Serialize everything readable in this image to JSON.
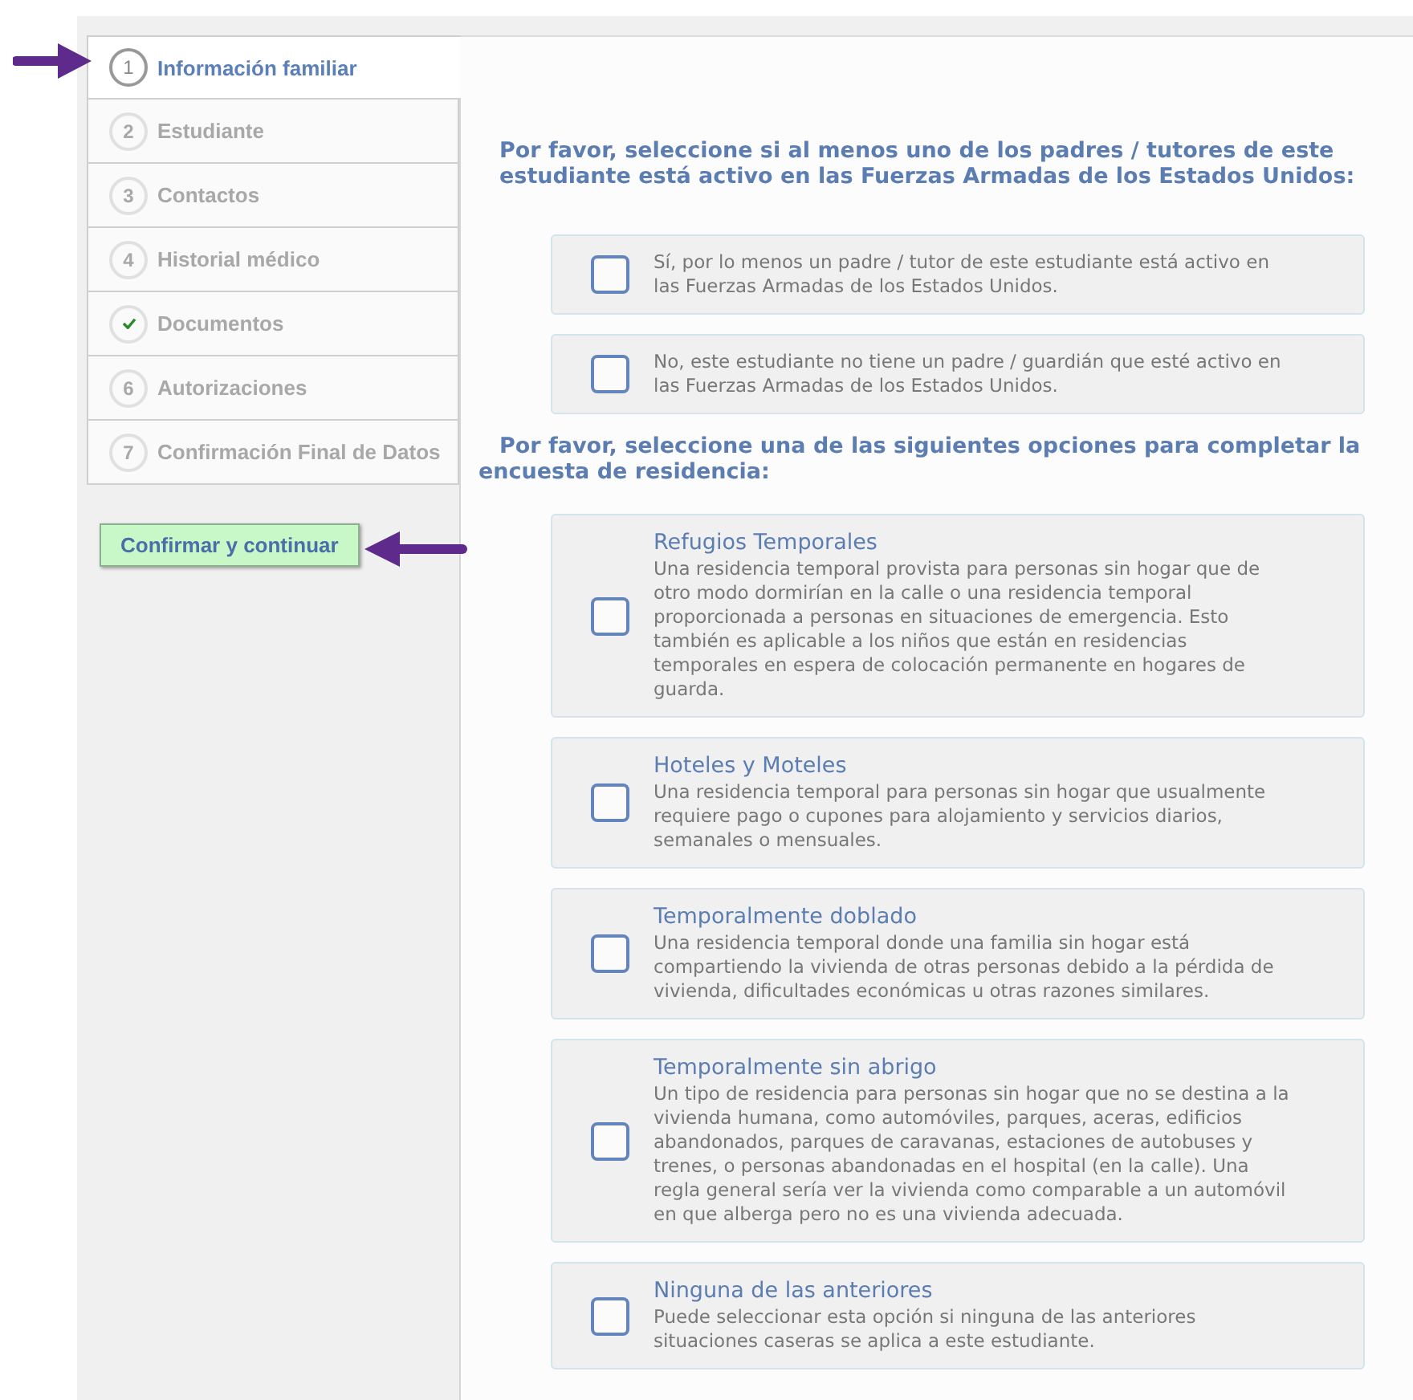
{
  "steps": [
    {
      "number": "1",
      "label": "Información familiar",
      "selected": true,
      "completed": false
    },
    {
      "number": "2",
      "label": "Estudiante",
      "selected": false,
      "completed": false
    },
    {
      "number": "3",
      "label": "Contactos",
      "selected": false,
      "completed": false
    },
    {
      "number": "4",
      "label": "Historial médico",
      "selected": false,
      "completed": false
    },
    {
      "label": "Documentos",
      "selected": false,
      "completed": true
    },
    {
      "number": "6",
      "label": "Autorizaciones",
      "selected": false,
      "completed": false
    },
    {
      "number": "7",
      "label": "Confirmación Final de Datos",
      "selected": false,
      "completed": false
    }
  ],
  "confirm_button": "Confirmar y continuar",
  "military_question": "Por favor, seleccione si al menos uno de los padres / tutores de este estudiante está activo en las Fuerzas Armadas de los Estados Unidos:",
  "military_options": [
    {
      "text": "Sí, por lo menos un padre / tutor de este estudiante está activo en las Fuerzas Armadas de los Estados Unidos.",
      "checked": false
    },
    {
      "text": "No, este estudiante no tiene un padre / guardián que esté activo en las Fuerzas Armadas de los Estados Unidos.",
      "checked": false
    }
  ],
  "residency_question": "Por favor, seleccione una de las siguientes opciones para completar la encuesta de residencia:",
  "residency_options": [
    {
      "title": "Refugios Temporales",
      "description": "Una residencia temporal provista para personas sin hogar que de otro modo dormirían en la calle o una residencia temporal proporcionada a personas en situaciones de emergencia. Esto también es aplicable a los niños que están en residencias temporales en espera de colocación permanente en hogares de guarda.",
      "checked": false
    },
    {
      "title": "Hoteles y Moteles",
      "description": "Una residencia temporal para personas sin hogar que usualmente requiere pago o cupones para alojamiento y servicios diarios, semanales o mensuales.",
      "checked": false
    },
    {
      "title": "Temporalmente doblado",
      "description": "Una residencia temporal donde una familia sin hogar está compartiendo la vivienda de otras personas debido a la pérdida de vivienda, dificultades económicas u otras razones similares.",
      "checked": false
    },
    {
      "title": "Temporalmente sin abrigo",
      "description": "Un tipo de residencia para personas sin hogar que no se destina a la vivienda humana, como automóviles, parques, aceras, edificios abandonados, parques de caravanas, estaciones de autobuses y trenes, o personas abandonadas en el hospital (en la calle). Una regla general sería ver la vivienda como comparable a un automóvil en que alberga pero no es una vivienda adecuada.",
      "checked": false
    },
    {
      "title": "Ninguna de las anteriores",
      "description": "Puede seleccionar esta opción si ninguna de las anteriores situaciones caseras se aplica a este estudiante.",
      "checked": false
    }
  ]
}
